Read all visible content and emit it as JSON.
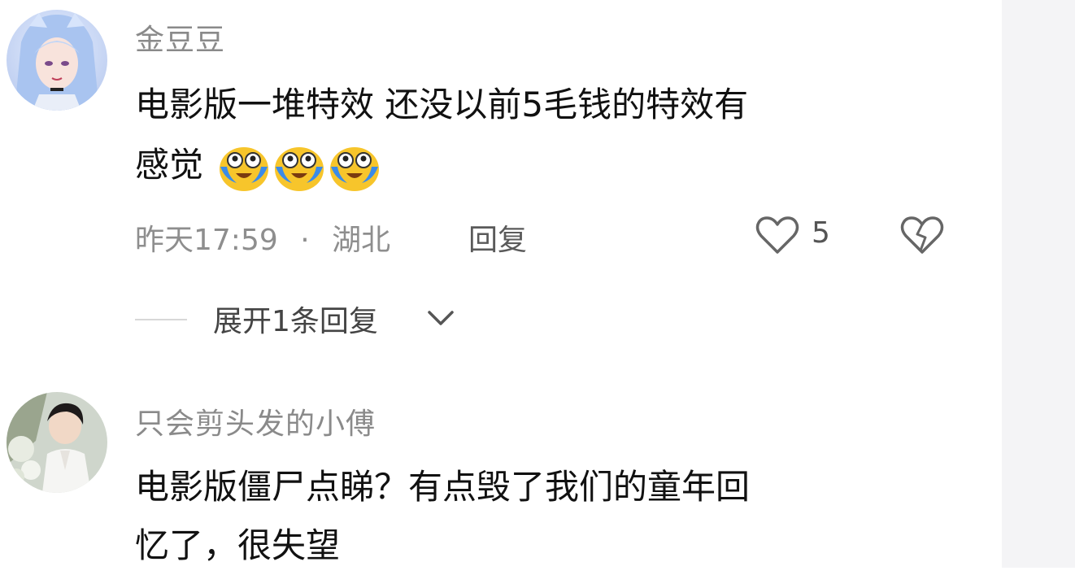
{
  "comments": [
    {
      "username": "金豆豆",
      "text_line1": "电影版一堆特效 还没以前5毛钱的特效有",
      "text_line2": "感觉",
      "emojis": [
        "crying-laugh-emoji",
        "crying-laugh-emoji",
        "crying-laugh-emoji"
      ],
      "time": "昨天17:59",
      "separator": "·",
      "location": "湖北",
      "reply_label": "回复",
      "like_count": "5",
      "expand_replies": "展开1条回复"
    },
    {
      "username": "只会剪头发的小傅",
      "text_line1": "电影版僵尸点睇？有点毁了我们的童年回",
      "text_line2": "忆了，很失望"
    }
  ],
  "colors": {
    "meta_gray": "#8e8e8e",
    "text_dark": "#111111",
    "emoji_yellow": "#f7c52b",
    "tear_blue": "#3b8be8"
  }
}
